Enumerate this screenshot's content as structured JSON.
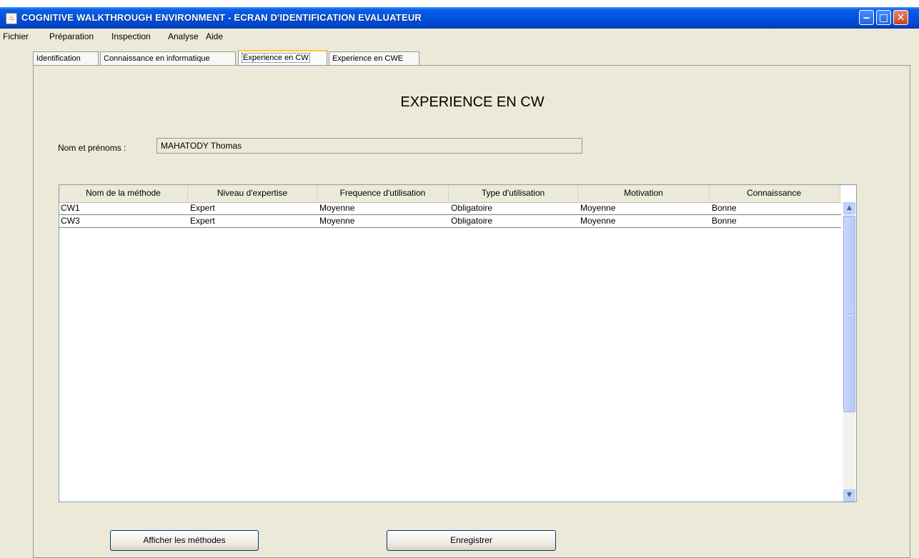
{
  "window": {
    "title": "COGNITIVE WALKTHROUGH ENVIRONMENT - ECRAN D'IDENTIFICATION EVALUATEUR",
    "app_icon": "java-cup-icon",
    "controls": {
      "minimize": "minimize-icon",
      "maximize": "maximize-icon",
      "close": "close-icon"
    }
  },
  "menu": [
    "Fichier",
    "Préparation",
    "Inspection",
    "Analyse",
    "Aide"
  ],
  "tabs": [
    {
      "label": "Identification",
      "active": false
    },
    {
      "label": "Connaissance en informatique",
      "active": false
    },
    {
      "label": "Experience en CW",
      "active": true
    },
    {
      "label": "Experience en CWE",
      "active": false
    }
  ],
  "panel": {
    "heading": "EXPERIENCE EN CW",
    "name_label": "Nom et prénoms :",
    "name_value": "MAHATODY Thomas"
  },
  "table": {
    "columns": [
      "Nom de la méthode",
      "Niveau d'expertise",
      "Frequence d'utilisation",
      "Type d'utilisation",
      "Motivation",
      "Connaissance"
    ],
    "rows": [
      [
        "CW1",
        "Expert",
        "Moyenne",
        "Obligatoire",
        "Moyenne",
        "Bonne"
      ],
      [
        "CW3",
        "Expert",
        "Moyenne",
        "Obligatoire",
        "Moyenne",
        "Bonne"
      ]
    ]
  },
  "buttons": {
    "show_methods": "Afficher les méthodes",
    "save": "Enregistrer"
  },
  "colors": {
    "titlebar": "#0054e3",
    "panel_bg": "#ece9d8",
    "active_tab_accent": "#ffc83c"
  }
}
